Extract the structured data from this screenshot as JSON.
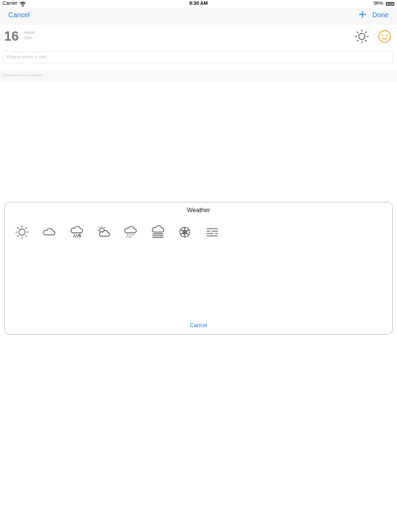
{
  "status_bar": {
    "carrier": "Carrier",
    "time": "9:30 AM",
    "battery": "96%"
  },
  "nav": {
    "cancel_label": "Cancel",
    "done_label": "Done",
    "add_icon": "plus-icon"
  },
  "date": {
    "day": "16",
    "month": "August",
    "year": "2018"
  },
  "header_icons": {
    "weather": "sun-icon",
    "mood": "smiley-icon"
  },
  "title_field": {
    "placeholder": "Please enter a title.",
    "value": ""
  },
  "content_field": {
    "placeholder": "Please enter your content",
    "value": ""
  },
  "weather_dialog": {
    "title": "Weather",
    "cancel_label": "Cancel",
    "options": [
      "sunny-icon",
      "cloudy-icon",
      "thunderstorm-icon",
      "partly-cloudy-icon",
      "snow-shower-icon",
      "fog-icon",
      "snowflake-icon",
      "haze-icon"
    ]
  },
  "colors": {
    "accent": "#1a7ee3",
    "mood": "#f2a93b",
    "nav_bg": "#f7f7f7"
  }
}
